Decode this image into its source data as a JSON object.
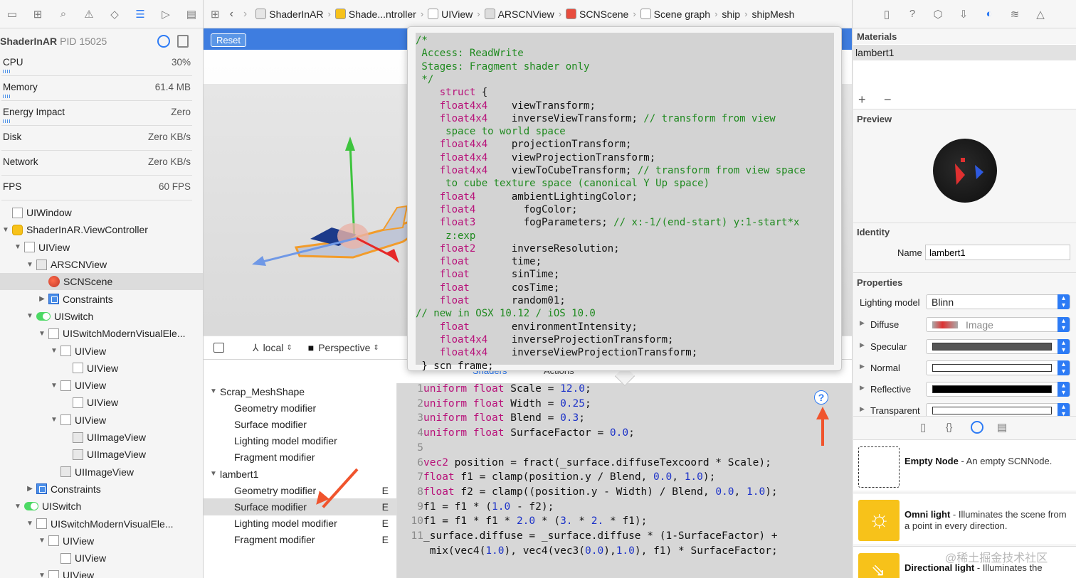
{
  "navigator": {
    "tab_icons": [
      "folder-icon",
      "hierarchy-icon",
      "search-icon",
      "warning-icon",
      "test-icon",
      "debug-icon",
      "breakpoint-icon",
      "report-icon"
    ],
    "process_name": "ShaderInAR",
    "process_pid": "PID 15025",
    "gauges": [
      {
        "label": "CPU",
        "value": "30%"
      },
      {
        "label": "Memory",
        "value": "61.4 MB"
      },
      {
        "label": "Energy Impact",
        "value": "Zero"
      },
      {
        "label": "Disk",
        "value": "Zero KB/s"
      },
      {
        "label": "Network",
        "value": "Zero KB/s"
      },
      {
        "label": "FPS",
        "value": "60 FPS"
      }
    ],
    "tree": [
      {
        "label": "UIWindow",
        "indent": 0,
        "icon": "view",
        "tri": ""
      },
      {
        "label": "ShaderInAR.ViewController",
        "indent": 0,
        "icon": "vc",
        "tri": "▼"
      },
      {
        "label": "UIView",
        "indent": 1,
        "icon": "view",
        "tri": "▼"
      },
      {
        "label": "ARSCNView",
        "indent": 2,
        "icon": "img",
        "tri": "▼"
      },
      {
        "label": "SCNScene",
        "indent": 3,
        "icon": "scene",
        "tri": "",
        "selected": true
      },
      {
        "label": "Constraints",
        "indent": 3,
        "icon": "constraint",
        "tri": "▶"
      },
      {
        "label": "UISwitch",
        "indent": 2,
        "icon": "switch",
        "tri": "▼"
      },
      {
        "label": "UISwitchModernVisualEle...",
        "indent": 3,
        "icon": "view",
        "tri": "▼"
      },
      {
        "label": "UIView",
        "indent": 4,
        "icon": "view",
        "tri": "▼"
      },
      {
        "label": "UIView",
        "indent": 5,
        "icon": "view",
        "tri": ""
      },
      {
        "label": "UIView",
        "indent": 4,
        "icon": "view",
        "tri": "▼"
      },
      {
        "label": "UIView",
        "indent": 5,
        "icon": "view",
        "tri": ""
      },
      {
        "label": "UIView",
        "indent": 4,
        "icon": "view",
        "tri": "▼"
      },
      {
        "label": "UIImageView",
        "indent": 5,
        "icon": "img",
        "tri": ""
      },
      {
        "label": "UIImageView",
        "indent": 5,
        "icon": "img",
        "tri": ""
      },
      {
        "label": "UIImageView",
        "indent": 4,
        "icon": "img",
        "tri": ""
      },
      {
        "label": "Constraints",
        "indent": 2,
        "icon": "constraint",
        "tri": "▶"
      },
      {
        "label": "UISwitch",
        "indent": 1,
        "icon": "switch",
        "tri": "▼"
      },
      {
        "label": "UISwitchModernVisualEle...",
        "indent": 2,
        "icon": "view",
        "tri": "▼"
      },
      {
        "label": "UIView",
        "indent": 3,
        "icon": "view",
        "tri": "▼"
      },
      {
        "label": "UIView",
        "indent": 4,
        "icon": "view",
        "tri": ""
      },
      {
        "label": "UIView",
        "indent": 3,
        "icon": "view",
        "tri": "▼"
      }
    ]
  },
  "jumpbar": {
    "crumbs": [
      "ShaderInAR",
      "Shade...ntroller",
      "UIView",
      "ARSCNView",
      "SCNScene",
      "Scene graph",
      "ship",
      "shipMesh"
    ]
  },
  "viewport": {
    "reset_label": "Reset",
    "space_label": "local",
    "camera_label": "Perspective"
  },
  "tabs": {
    "shaders": "Shaders",
    "actions": "Actions"
  },
  "modifiers": [
    {
      "label": "Scrap_MeshShape",
      "group": true,
      "tri": "▼",
      "e": ""
    },
    {
      "label": "Geometry modifier",
      "group": false,
      "e": ""
    },
    {
      "label": "Surface modifier",
      "group": false,
      "e": ""
    },
    {
      "label": "Lighting model modifier",
      "group": false,
      "e": ""
    },
    {
      "label": "Fragment modifier",
      "group": false,
      "e": ""
    },
    {
      "label": "lambert1",
      "group": true,
      "tri": "▼",
      "e": ""
    },
    {
      "label": "Geometry modifier",
      "group": false,
      "e": "E"
    },
    {
      "label": "Surface modifier",
      "group": false,
      "e": "E",
      "selected": true
    },
    {
      "label": "Lighting model modifier",
      "group": false,
      "e": "E"
    },
    {
      "label": "Fragment modifier",
      "group": false,
      "e": "E"
    }
  ],
  "code_lines": [
    {
      "n": "1",
      "t": "uniform float Scale = 12.0;"
    },
    {
      "n": "2",
      "t": "uniform float Width = 0.25;"
    },
    {
      "n": "3",
      "t": "uniform float Blend = 0.3;"
    },
    {
      "n": "4",
      "t": "uniform float SurfaceFactor = 0.0;"
    },
    {
      "n": "5",
      "t": ""
    },
    {
      "n": "6",
      "t": "vec2 position = fract(_surface.diffuseTexcoord * Scale);"
    },
    {
      "n": "7",
      "t": "float f1 = clamp(position.y / Blend, 0.0, 1.0);"
    },
    {
      "n": "8",
      "t": "float f2 = clamp((position.y - Width) / Blend, 0.0, 1.0);"
    },
    {
      "n": "9",
      "t": "f1 = f1 * (1.0 - f2);"
    },
    {
      "n": "10",
      "t": "f1 = f1 * f1 * 2.0 * (3. * 2. * f1);"
    },
    {
      "n": "11",
      "t": "_surface.diffuse = _surface.diffuse * (1-SurfaceFactor) +"
    },
    {
      "n": "",
      "t": " mix(vec4(1.0), vec4(vec3(0.0),1.0), f1) * SurfaceFactor;"
    }
  ],
  "tooltip_lines": [
    {
      "t": "/*",
      "c": "cm"
    },
    {
      "t": " Access: ReadWrite",
      "c": "cm"
    },
    {
      "t": " Stages: Fragment shader only",
      "c": "cm"
    },
    {
      "t": " */",
      "c": "cm"
    },
    {
      "k": "    struct",
      "r": " {"
    },
    {
      "k": "    float4x4",
      "r": "    viewTransform;"
    },
    {
      "k": "    float4x4",
      "r": "    inverseViewTransform;",
      "cm": " // transform from view"
    },
    {
      "t": "     space to world space",
      "c": "cm"
    },
    {
      "k": "    float4x4",
      "r": "    projectionTransform;"
    },
    {
      "k": "    float4x4",
      "r": "    viewProjectionTransform;"
    },
    {
      "k": "    float4x4",
      "r": "    viewToCubeTransform;",
      "cm": " // transform from view space"
    },
    {
      "t": "     to cube texture space (canonical Y Up space)",
      "c": "cm"
    },
    {
      "k": "    float4",
      "r": "      ambientLightingColor;"
    },
    {
      "k": "    float4",
      "r": "        fogColor;"
    },
    {
      "k": "    float3",
      "r": "        fogParameters;",
      "cm": " // x:-1/(end-start) y:1-start*x"
    },
    {
      "t": "     z:exp",
      "c": "cm"
    },
    {
      "k": "    float2",
      "r": "      inverseResolution;"
    },
    {
      "k": "    float",
      "r": "       time;"
    },
    {
      "k": "    float",
      "r": "       sinTime;"
    },
    {
      "k": "    float",
      "r": "       cosTime;"
    },
    {
      "k": "    float",
      "r": "       random01;"
    },
    {
      "t": "// new in OSX 10.12 / iOS 10.0",
      "c": "cm"
    },
    {
      "k": "    float",
      "r": "       environmentIntensity;"
    },
    {
      "k": "    float4x4",
      "r": "    inverseProjectionTransform;"
    },
    {
      "k": "    float4x4",
      "r": "    inverseViewProjectionTransform;"
    },
    {
      "t": " } scn_frame;",
      "c": ""
    }
  ],
  "inspector": {
    "tab_icons": [
      "file-icon",
      "help-icon",
      "cube-icon",
      "attributes-icon",
      "material-icon",
      "physics-icon",
      "effects-icon"
    ],
    "materials_title": "Materials",
    "material_selected": "lambert1",
    "add_label": "+",
    "remove_label": "−",
    "preview_title": "Preview",
    "identity_title": "Identity",
    "name_label": "Name",
    "name_value": "lambert1",
    "properties_title": "Properties",
    "lighting_label": "Lighting model",
    "lighting_value": "Blinn",
    "props": [
      {
        "label": "Diffuse",
        "value": "Image",
        "swatch": "image"
      },
      {
        "label": "Specular",
        "value": "",
        "swatch": "#555555"
      },
      {
        "label": "Normal",
        "value": "",
        "swatch": "#ffffff"
      },
      {
        "label": "Reflective",
        "value": "",
        "swatch": "#000000"
      },
      {
        "label": "Transparent",
        "value": "",
        "swatch": "#ffffff"
      }
    ],
    "library_tab_icons": [
      "file-template-icon",
      "code-snippet-icon",
      "object-library-icon",
      "media-library-icon"
    ],
    "library": [
      {
        "title": "Empty Node",
        "desc": " - An empty SCNNode.",
        "icon": "empty-node-icon"
      },
      {
        "title": "Omni light",
        "desc": " - Illuminates the scene from a point in every direction.",
        "icon": "omni-light-icon"
      },
      {
        "title": "Directional light",
        "desc": " - Illuminates the",
        "icon": "directional-light-icon"
      }
    ],
    "watermark": "@稀土掘金技术社区"
  },
  "colors": {
    "accent": "#2d7bf5",
    "arrow": "#f0542d",
    "comment": "#1f8a1f",
    "keyword": "#b8127a",
    "number": "#1c32c8"
  }
}
